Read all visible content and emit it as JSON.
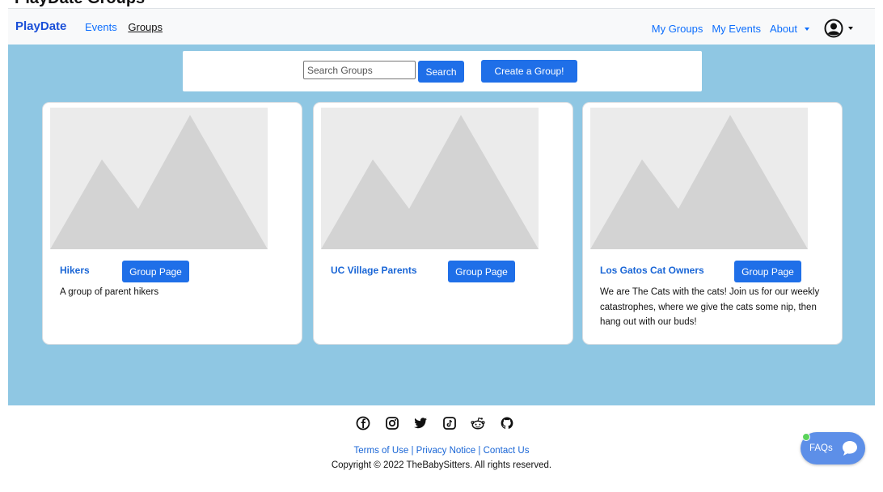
{
  "page": {
    "cut_title": "PlayDate Groups",
    "colors": {
      "main_bg": "#8fc7e3",
      "accent": "#1f6fe8",
      "link": "#0d6efd"
    }
  },
  "navbar": {
    "brand": "PlayDate",
    "left_links": [
      {
        "label": "Events",
        "active": false
      },
      {
        "label": "Groups",
        "active": true
      }
    ],
    "right_links": [
      {
        "label": "My Groups"
      },
      {
        "label": "My Events"
      },
      {
        "label": "About",
        "dropdown": true
      }
    ],
    "user_icon": "user-circle-icon"
  },
  "search": {
    "placeholder": "Search Groups",
    "value": "",
    "search_label": "Search",
    "create_label": "Create a Group!"
  },
  "groups": [
    {
      "name": "Hikers",
      "button_label": "Group Page",
      "description": "A group of parent hikers"
    },
    {
      "name": "UC Village Parents",
      "button_label": "Group Page",
      "description": ""
    },
    {
      "name": "Los Gatos Cat Owners",
      "button_label": "Group Page",
      "description": "We are The Cats with the cats! Join us for our weekly catastrophes, where we give the cats some nip, then hang out with our buds!"
    }
  ],
  "footer": {
    "social_icons": [
      "facebook-icon",
      "instagram-icon",
      "twitter-icon",
      "tiktok-icon",
      "reddit-icon",
      "github-icon"
    ],
    "links": [
      "Terms of Use",
      "Privacy Notice",
      "Contact Us"
    ],
    "separator": " | ",
    "copyright": "Copyright © 2022 TheBabySitters. All rights reserved."
  },
  "faq": {
    "label": "FAQs",
    "icon": "chat-bubble-icon"
  }
}
